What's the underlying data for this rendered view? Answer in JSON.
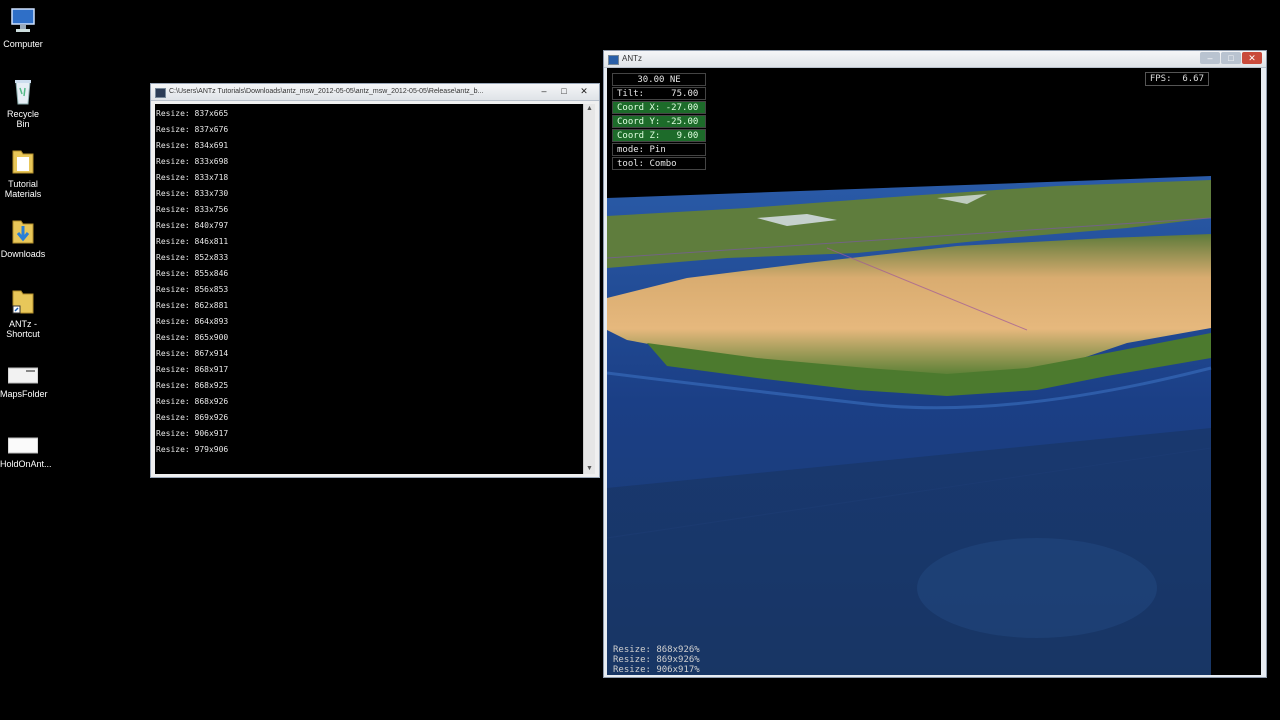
{
  "desktop": {
    "icons": [
      {
        "label": "Computer",
        "icon": "computer-icon"
      },
      {
        "label": "Recycle Bin",
        "icon": "recycle-bin-icon"
      },
      {
        "label": "Tutorial Materials",
        "icon": "folder-icon"
      },
      {
        "label": "Downloads",
        "icon": "downloads-folder-icon"
      },
      {
        "label": "ANTz - Shortcut",
        "icon": "shortcut-icon"
      },
      {
        "label": "MapsFolder",
        "icon": "file-icon"
      },
      {
        "label": "HoldOnAnt...",
        "icon": "file-icon"
      }
    ]
  },
  "console_window": {
    "title": "C:\\Users\\ANTz Tutorials\\Downloads\\antz_msw_2012-05-05\\antz_msw_2012-05-05\\Release\\antz_b...",
    "buttons": {
      "minimize": "–",
      "maximize": "□",
      "close": "✕"
    },
    "lines": [
      "Resize: 837x665",
      "Resize: 837x676",
      "Resize: 834x691",
      "Resize: 833x698",
      "Resize: 833x718",
      "Resize: 833x730",
      "Resize: 833x756",
      "Resize: 840x797",
      "Resize: 846x811",
      "Resize: 852x833",
      "Resize: 855x846",
      "Resize: 856x853",
      "Resize: 862x881",
      "Resize: 864x893",
      "Resize: 865x900",
      "Resize: 867x914",
      "Resize: 868x917",
      "Resize: 868x925",
      "Resize: 868x926",
      "Resize: 869x926",
      "Resize: 906x917",
      "Resize: 979x906"
    ]
  },
  "antz_window": {
    "title": "ANTz",
    "buttons": {
      "minimize": "–",
      "maximize": "□",
      "close": "✕"
    },
    "hud": {
      "heading": "30.00 NE",
      "tilt": "Tilt:     75.00",
      "coord_x": "Coord X: -27.00",
      "coord_y": "Coord Y: -25.00",
      "coord_z": "Coord Z:   9.00",
      "mode": "mode: Pin",
      "tool": "tool: Combo"
    },
    "fps": "FPS:  6.67",
    "log": [
      "Resize: 868x926%",
      "Resize: 869x926%",
      "Resize: 906x917%"
    ]
  },
  "colors": {
    "ocean": "#1b3f86",
    "desert": "#e6b87d",
    "vegetation": "#4c7a2e",
    "hud_green": "#1d6b2a"
  }
}
